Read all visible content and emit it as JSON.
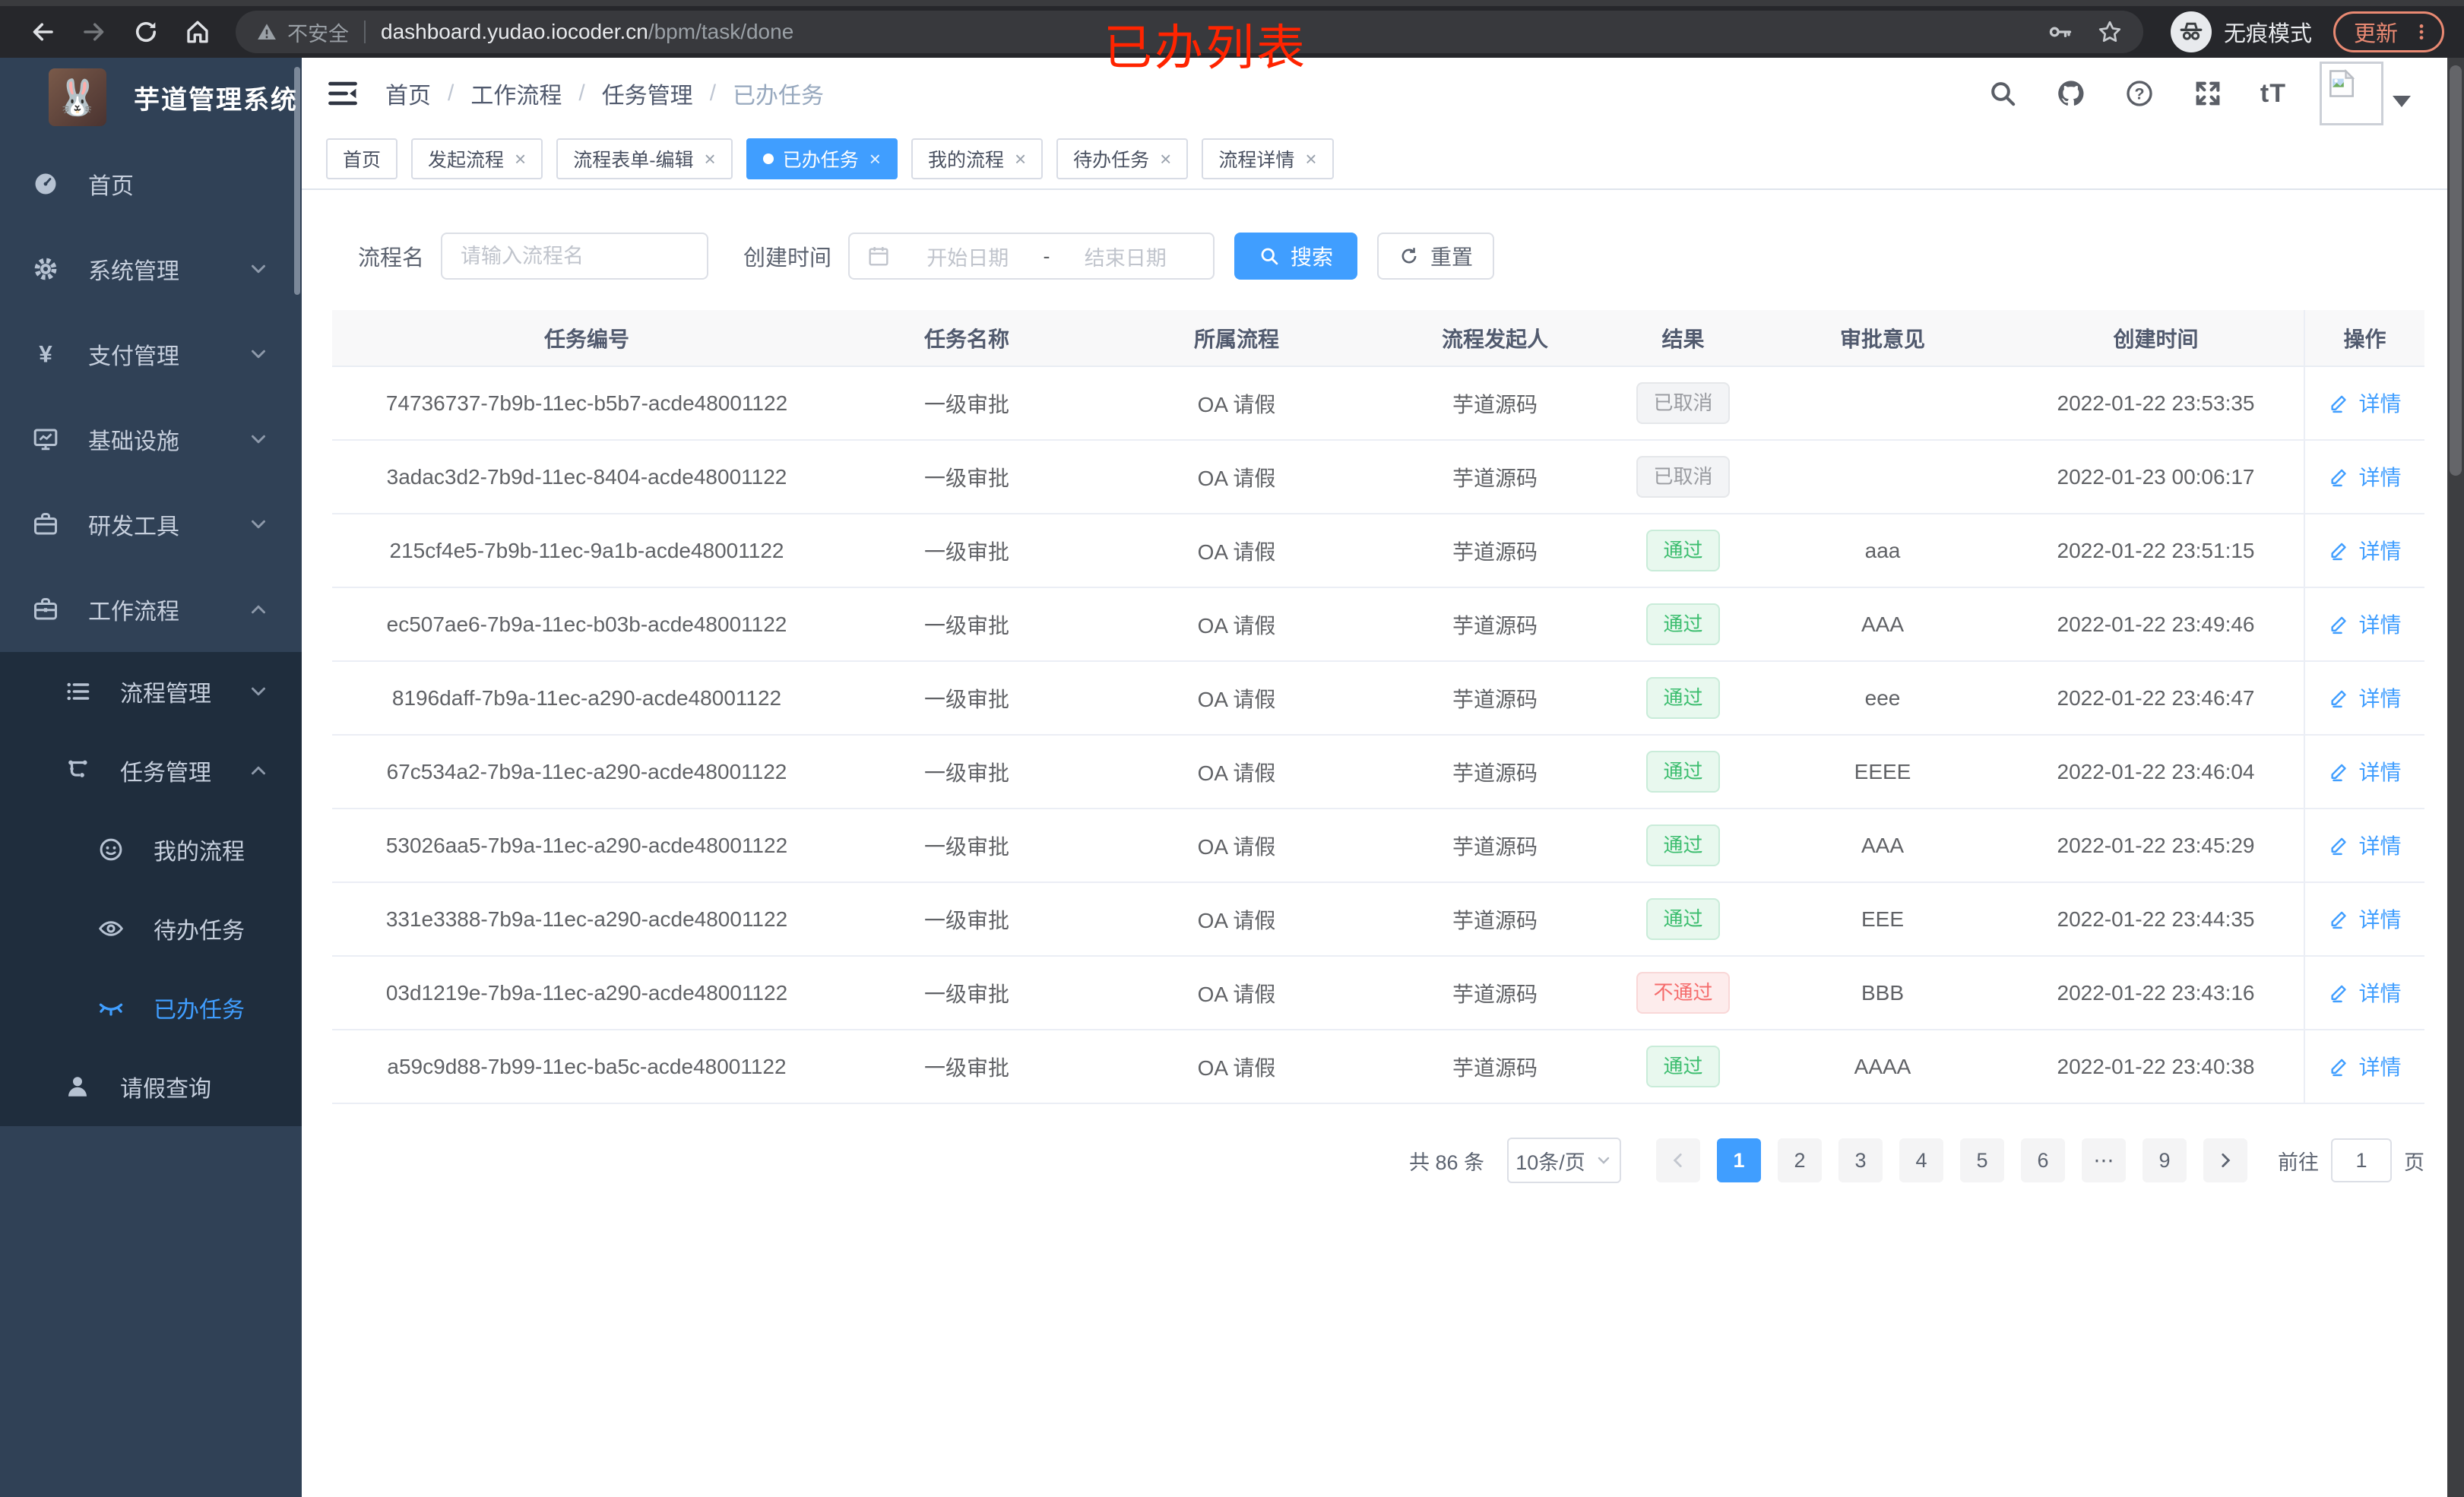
{
  "colors": {
    "accent": "#409eff",
    "sidebar_bg": "#304156",
    "submenu_bg": "#1f2d3d",
    "pass_text": "#3bbd6e",
    "pass_bg": "#e8f8ee",
    "fail_text": "#f56c6c",
    "fail_bg": "#fdecec",
    "cancel_text": "#9a9ca1",
    "cancel_bg": "#f3f4f6",
    "update_accent": "#e98972",
    "annotation_red": "#ff2400"
  },
  "browser": {
    "security_label": "不安全",
    "url_host": "dashboard.yudao.iocoder.cn",
    "url_path": "/bpm/task/done",
    "incognito_label": "无痕模式",
    "update_label": "更新"
  },
  "annotation": "已办列表",
  "sidebar": {
    "logo_title": "芋道管理系统",
    "items": [
      {
        "key": "home",
        "label": "首页",
        "icon": "gauge-icon",
        "level": "top"
      },
      {
        "key": "system",
        "label": "系统管理",
        "icon": "gear-icon",
        "level": "top",
        "chevron": "down"
      },
      {
        "key": "payment",
        "label": "支付管理",
        "icon": "yen-icon",
        "level": "top",
        "chevron": "down"
      },
      {
        "key": "infrastructure",
        "label": "基础设施",
        "icon": "monitor-icon",
        "level": "top",
        "chevron": "down"
      },
      {
        "key": "devtools",
        "label": "研发工具",
        "icon": "briefcase-icon",
        "level": "top",
        "chevron": "down"
      },
      {
        "key": "workflow",
        "label": "工作流程",
        "icon": "toolbox-icon",
        "level": "top",
        "chevron": "up"
      },
      {
        "key": "process-mgmt",
        "label": "流程管理",
        "icon": "list-icon",
        "level": "sub1",
        "chevron": "down"
      },
      {
        "key": "task-mgmt",
        "label": "任务管理",
        "icon": "flow-icon",
        "level": "sub1",
        "chevron": "up"
      },
      {
        "key": "my-process",
        "label": "我的流程",
        "icon": "face-icon",
        "level": "sub2"
      },
      {
        "key": "todo-tasks",
        "label": "待办任务",
        "icon": "eye-icon",
        "level": "sub2"
      },
      {
        "key": "done-tasks",
        "label": "已办任务",
        "icon": "eye-closed-icon",
        "level": "sub2",
        "active": true
      },
      {
        "key": "leave-query",
        "label": "请假查询",
        "icon": "person-icon",
        "level": "sub1"
      }
    ]
  },
  "breadcrumb": [
    {
      "key": "home",
      "label": "首页"
    },
    {
      "key": "workflow",
      "label": "工作流程"
    },
    {
      "key": "task-mgmt",
      "label": "任务管理"
    },
    {
      "key": "done-tasks",
      "label": "已办任务"
    }
  ],
  "tabs": [
    {
      "key": "home",
      "label": "首页",
      "closable": false
    },
    {
      "key": "start-process",
      "label": "发起流程",
      "closable": true
    },
    {
      "key": "form-edit",
      "label": "流程表单-编辑",
      "closable": true
    },
    {
      "key": "done-tasks",
      "label": "已办任务",
      "closable": true,
      "active": true
    },
    {
      "key": "my-process",
      "label": "我的流程",
      "closable": true
    },
    {
      "key": "todo-tasks",
      "label": "待办任务",
      "closable": true
    },
    {
      "key": "process-detail",
      "label": "流程详情",
      "closable": true
    }
  ],
  "filters": {
    "name_label": "流程名",
    "name_placeholder": "请输入流程名",
    "time_label": "创建时间",
    "start_placeholder": "开始日期",
    "range_separator": "-",
    "end_placeholder": "结束日期",
    "search_label": "搜索",
    "reset_label": "重置"
  },
  "table": {
    "headers": [
      "任务编号",
      "任务名称",
      "所属流程",
      "流程发起人",
      "结果",
      "审批意见",
      "创建时间",
      "操作"
    ],
    "action_label": "详情",
    "rows": [
      {
        "id": "74736737-7b9b-11ec-b5b7-acde48001122",
        "name": "一级审批",
        "process": "OA 请假",
        "starter": "芋道源码",
        "result": "已取消",
        "result_type": "cancel",
        "comment": "",
        "created": "2022-01-22 23:53:35"
      },
      {
        "id": "3adac3d2-7b9d-11ec-8404-acde48001122",
        "name": "一级审批",
        "process": "OA 请假",
        "starter": "芋道源码",
        "result": "已取消",
        "result_type": "cancel",
        "comment": "",
        "created": "2022-01-23 00:06:17"
      },
      {
        "id": "215cf4e5-7b9b-11ec-9a1b-acde48001122",
        "name": "一级审批",
        "process": "OA 请假",
        "starter": "芋道源码",
        "result": "通过",
        "result_type": "pass",
        "comment": "aaa",
        "created": "2022-01-22 23:51:15"
      },
      {
        "id": "ec507ae6-7b9a-11ec-b03b-acde48001122",
        "name": "一级审批",
        "process": "OA 请假",
        "starter": "芋道源码",
        "result": "通过",
        "result_type": "pass",
        "comment": "AAA",
        "created": "2022-01-22 23:49:46"
      },
      {
        "id": "8196daff-7b9a-11ec-a290-acde48001122",
        "name": "一级审批",
        "process": "OA 请假",
        "starter": "芋道源码",
        "result": "通过",
        "result_type": "pass",
        "comment": "eee",
        "created": "2022-01-22 23:46:47"
      },
      {
        "id": "67c534a2-7b9a-11ec-a290-acde48001122",
        "name": "一级审批",
        "process": "OA 请假",
        "starter": "芋道源码",
        "result": "通过",
        "result_type": "pass",
        "comment": "EEEE",
        "created": "2022-01-22 23:46:04"
      },
      {
        "id": "53026aa5-7b9a-11ec-a290-acde48001122",
        "name": "一级审批",
        "process": "OA 请假",
        "starter": "芋道源码",
        "result": "通过",
        "result_type": "pass",
        "comment": "AAA",
        "created": "2022-01-22 23:45:29"
      },
      {
        "id": "331e3388-7b9a-11ec-a290-acde48001122",
        "name": "一级审批",
        "process": "OA 请假",
        "starter": "芋道源码",
        "result": "通过",
        "result_type": "pass",
        "comment": "EEE",
        "created": "2022-01-22 23:44:35"
      },
      {
        "id": "03d1219e-7b9a-11ec-a290-acde48001122",
        "name": "一级审批",
        "process": "OA 请假",
        "starter": "芋道源码",
        "result": "不通过",
        "result_type": "fail",
        "comment": "BBB",
        "created": "2022-01-22 23:43:16"
      },
      {
        "id": "a59c9d88-7b99-11ec-ba5c-acde48001122",
        "name": "一级审批",
        "process": "OA 请假",
        "starter": "芋道源码",
        "result": "通过",
        "result_type": "pass",
        "comment": "AAAA",
        "created": "2022-01-22 23:40:38"
      }
    ]
  },
  "pagination": {
    "total_label": "共 86 条",
    "page_size": "10条/页",
    "pages": [
      "1",
      "2",
      "3",
      "4",
      "5",
      "6",
      "⋯",
      "9"
    ],
    "active_page": "1",
    "goto_label": "前往",
    "goto_value": "1",
    "page_unit": "页"
  }
}
